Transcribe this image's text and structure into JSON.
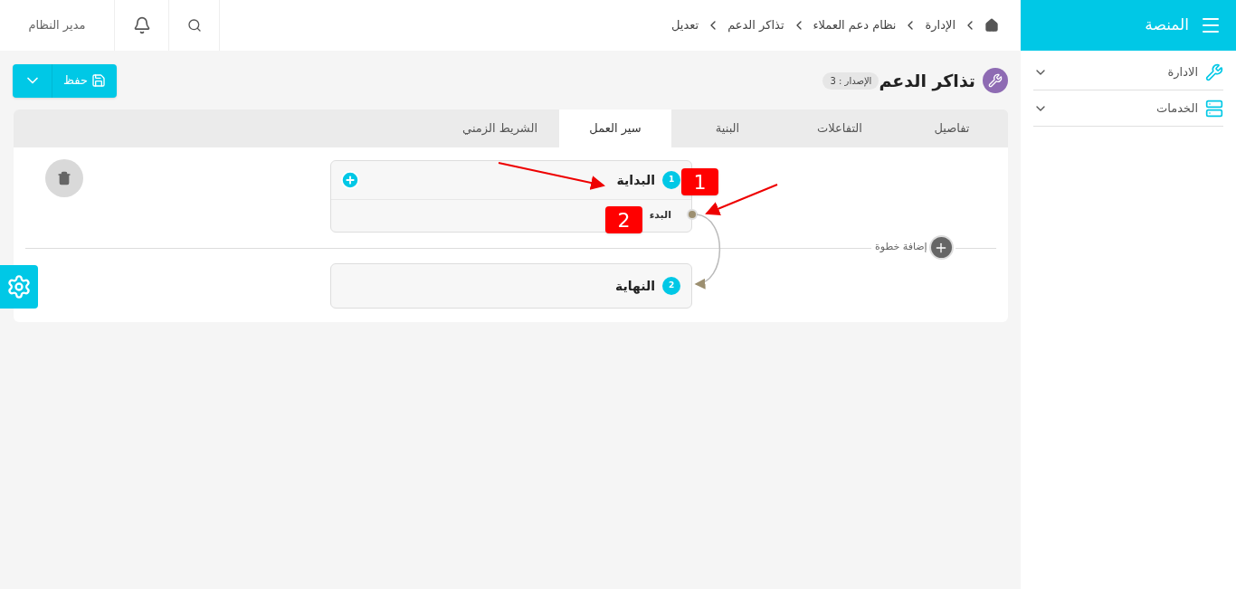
{
  "sidebar": {
    "title": "المنصة",
    "items": [
      {
        "label": "الادارة"
      },
      {
        "label": "الخدمات"
      }
    ]
  },
  "topbar": {
    "breadcrumbs": [
      "الإدارة",
      "نظام دعم العملاء",
      "تذاكر الدعم",
      "تعديل"
    ],
    "user": "مدير النظام"
  },
  "header": {
    "title": "تذاكر الدعم",
    "version_badge": "الإصدار : 3",
    "save_button": "حفظ"
  },
  "tabs": [
    {
      "label": "تفاصيل",
      "selected": false
    },
    {
      "label": "التفاعلات",
      "selected": false
    },
    {
      "label": "البنية",
      "selected": false
    },
    {
      "label": "سير العمل",
      "selected": true
    },
    {
      "label": "الشريط الزمني",
      "selected": false
    }
  ],
  "workflow": {
    "steps": [
      {
        "number": "1",
        "title": "البداية",
        "transitions": [
          "البدء"
        ]
      },
      {
        "number": "2",
        "title": "النهاية"
      }
    ],
    "add_step": "إضافة خطوة",
    "annotations": [
      "1",
      "2"
    ]
  }
}
